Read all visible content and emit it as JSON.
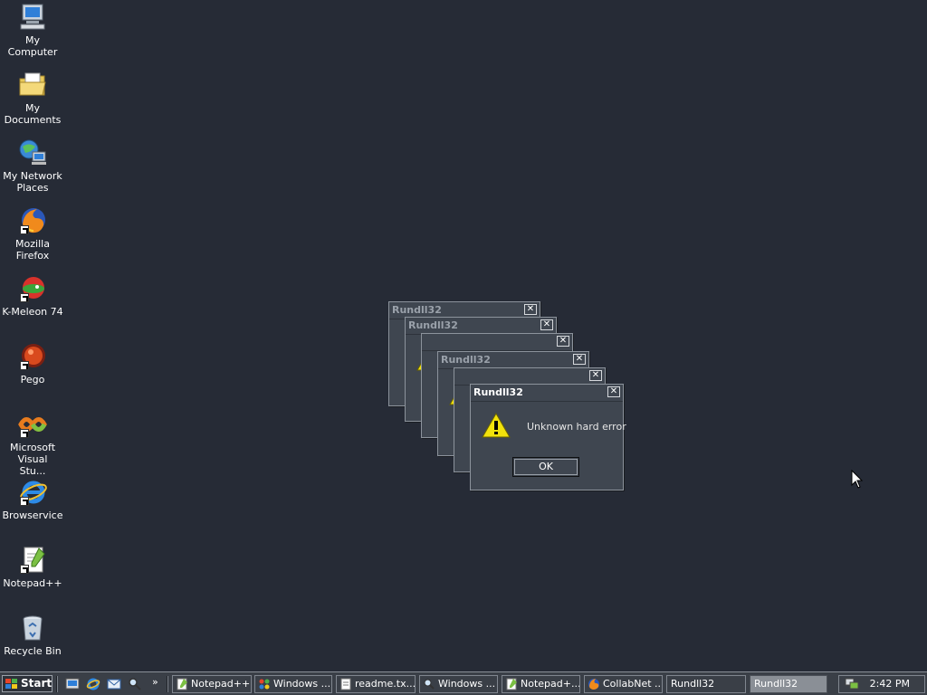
{
  "desktop": {
    "icons": [
      {
        "label": "My Computer",
        "icon": "computer-icon"
      },
      {
        "label": "My Documents",
        "icon": "folder-icon"
      },
      {
        "label": "My Network Places",
        "icon": "network-icon"
      },
      {
        "label": "Mozilla Firefox",
        "icon": "firefox-icon"
      },
      {
        "label": "K-Meleon 74",
        "icon": "kmeleon-icon"
      },
      {
        "label": "Pego",
        "icon": "pego-icon"
      },
      {
        "label": "Microsoft Visual Stu...",
        "icon": "visual-studio-icon"
      },
      {
        "label": "Browservice",
        "icon": "ie-icon"
      },
      {
        "label": "Notepad++",
        "icon": "notepadpp-icon"
      },
      {
        "label": "Recycle Bin",
        "icon": "recycle-bin-icon"
      }
    ]
  },
  "dialogs": {
    "title": "Rundll32",
    "message": "Unknown hard error",
    "ok_label": "OK",
    "close_glyph": "✕"
  },
  "taskbar": {
    "start_label": "Start",
    "overflow": "»",
    "tasks": [
      {
        "label": "Notepad++",
        "icon": "notepadpp-icon"
      },
      {
        "label": "Windows ...",
        "icon": "windows-explorer-icon"
      },
      {
        "label": "readme.tx...",
        "icon": "text-file-icon"
      },
      {
        "label": "Windows ...",
        "icon": "search-icon"
      },
      {
        "label": "Notepad+...",
        "icon": "notepadpp-icon"
      },
      {
        "label": "CollabNet ...",
        "icon": "firefox-icon"
      },
      {
        "label": "Rundll32",
        "icon": ""
      },
      {
        "label": "Rundll32",
        "icon": ""
      }
    ],
    "clock": "2:42 PM"
  },
  "colors": {
    "desktop": "#262b36",
    "window": "#3f4650",
    "warning": "#f2e20c"
  }
}
